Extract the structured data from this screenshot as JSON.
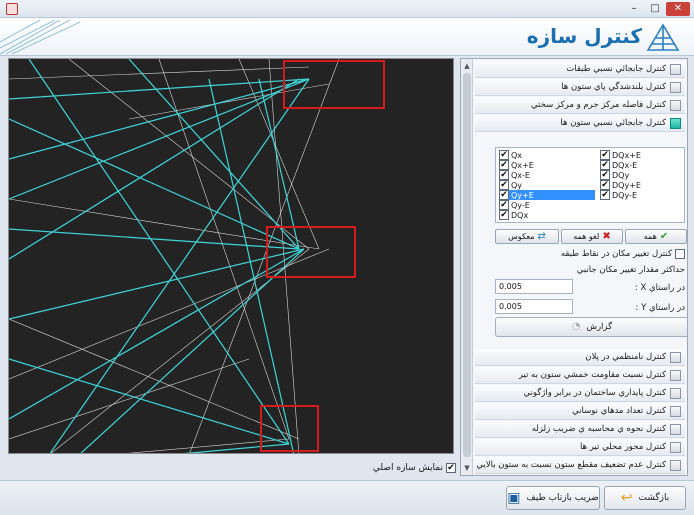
{
  "window": {
    "min_glyph": "–",
    "max_glyph": "□",
    "close_glyph": "✕"
  },
  "header": {
    "title": "كنترل سازه"
  },
  "viewport": {
    "show_original_label": "نمايش سازه اصلي",
    "show_original_checked": true
  },
  "panel": {
    "items_top": [
      {
        "label": "كنترل جابجائي نسبي طبقات",
        "active": false
      },
      {
        "label": "كنترل بلندشدگي پاي ستون ها",
        "active": false
      },
      {
        "label": "كنترل فاصله مركز جرم و مركز سختي",
        "active": false
      },
      {
        "label": "كنترل جابجائي نسبي ستون ها",
        "active": true
      }
    ],
    "combos_left": [
      {
        "label": "Qx",
        "checked": true,
        "selected": false
      },
      {
        "label": "Qx+E",
        "checked": true,
        "selected": false
      },
      {
        "label": "Qx-E",
        "checked": true,
        "selected": false
      },
      {
        "label": "Qy",
        "checked": true,
        "selected": false
      },
      {
        "label": "Qy+E",
        "checked": true,
        "selected": true
      },
      {
        "label": "Qy-E",
        "checked": true,
        "selected": false
      },
      {
        "label": "DQx",
        "checked": true,
        "selected": false
      }
    ],
    "combos_right": [
      {
        "label": "DQx+E",
        "checked": true
      },
      {
        "label": "DQx-E",
        "checked": true
      },
      {
        "label": "DQy",
        "checked": true
      },
      {
        "label": "DQy+E",
        "checked": true
      },
      {
        "label": "DQy-E",
        "checked": true
      }
    ],
    "buttons": {
      "all": "همه",
      "none": "لغو همه",
      "invert": "معكوس"
    },
    "change_location_label": "كنترل تغيير مكان در نقاط طبقه",
    "max_change_label": "حداكثر مقدار تغيير مكان جانبي",
    "x_label": "در راستاي X :",
    "x_value": "0.005",
    "y_label": "در راستاي Y :",
    "y_value": "0.005",
    "report_label": "گزارش",
    "items_bottom": [
      {
        "label": "كنترل نامنظمي در پلان"
      },
      {
        "label": "كنترل نسبت مقاومت خمشي ستون به تير"
      },
      {
        "label": "كنترل پايداري ساختمان در برابر واژگوني"
      },
      {
        "label": "كنترل تعداد مدهاي نوساني"
      },
      {
        "label": "كنترل نحوه ي محاسبه ي ضريب زلزله"
      },
      {
        "label": "كنترل محور محلي تير ها"
      },
      {
        "label": "كنترل عدم تضعيف مقطع ستون نسبت به ستون بالايي اش"
      }
    ]
  },
  "footer": {
    "back_label": "بازگشت",
    "spectrum_label": "ضريب بازتاب طيف"
  },
  "colors": {
    "accent": "#1a6fb0",
    "highlight": "#d41c1c",
    "members": "#3fd6d8"
  }
}
